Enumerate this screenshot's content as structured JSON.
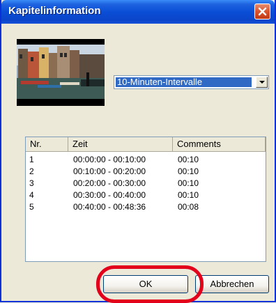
{
  "window": {
    "title": "Kapitelinformation"
  },
  "interval_select": {
    "value": "10-Minuten-Intervalle"
  },
  "chapter_list": {
    "columns": [
      "Nr.",
      "Zeit",
      "Comments"
    ],
    "rows": [
      [
        "1",
        "00:00:00 - 00:10:00",
        "00:10"
      ],
      [
        "2",
        "00:10:00 - 00:20:00",
        "00:10"
      ],
      [
        "3",
        "00:20:00 - 00:30:00",
        "00:10"
      ],
      [
        "4",
        "00:30:00 - 00:40:00",
        "00:10"
      ],
      [
        "5",
        "00:40:00 - 00:48:36",
        "00:08"
      ]
    ]
  },
  "buttons": {
    "ok": "OK",
    "cancel": "Abbrechen"
  },
  "colors": {
    "titlebar": "#0A4ED6",
    "selection": "#316AC5",
    "highlight_ring": "#E3001B",
    "close_button": "#D9532E"
  },
  "icons": {
    "close": "close-x-icon",
    "dropdown": "chevron-down-icon"
  }
}
